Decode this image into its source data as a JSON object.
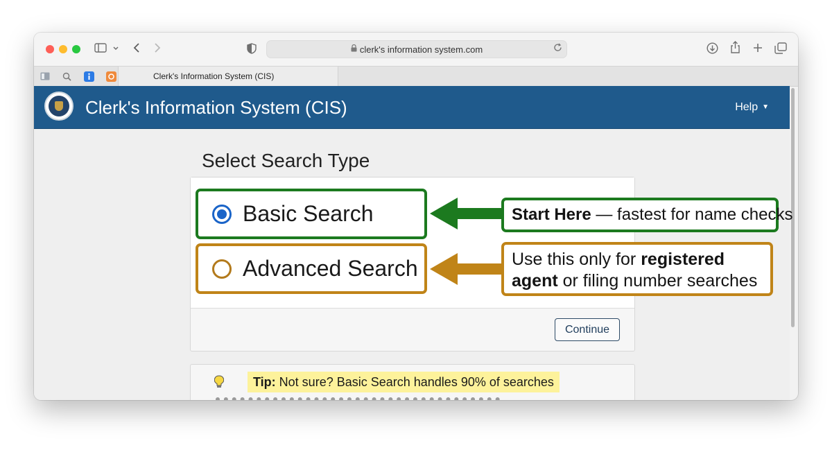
{
  "browser": {
    "url": "clerk's information system.com",
    "tab_title": "Clerk's Information System (CIS)"
  },
  "header": {
    "title": "Clerk's Information System (CIS)",
    "help_label": "Help"
  },
  "search": {
    "heading": "Select Search Type",
    "options": [
      {
        "label": "Basic Search",
        "selected": true
      },
      {
        "label": "Advanced Search",
        "selected": false
      }
    ],
    "continue_label": "Continue"
  },
  "tip": {
    "label": "Tip:",
    "text": " Not sure? Basic Search handles 90% of searches"
  },
  "callouts": {
    "basic": {
      "strong": "Start Here",
      "rest": " — fastest for name checks"
    },
    "advanced": {
      "before": "Use this only for ",
      "strong1": "registered",
      "strong2": "agent",
      "after": " or filing number searches"
    }
  },
  "colors": {
    "header_blue": "#1f5a8c",
    "basic_green": "#1c7a1f",
    "advanced_orange": "#c08418",
    "radio_blue": "#1a64c8",
    "tip_highlight": "#fdf29b"
  }
}
